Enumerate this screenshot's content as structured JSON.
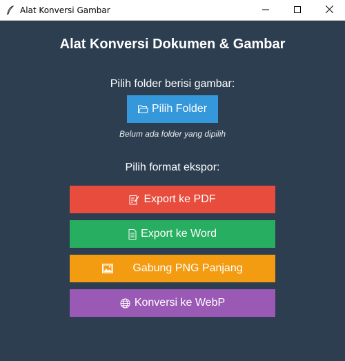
{
  "window": {
    "title": "Alat Konversi Gambar",
    "icons": {
      "app": "feather-icon",
      "minimize": "minimize-icon",
      "maximize": "maximize-icon",
      "close": "close-icon"
    }
  },
  "main": {
    "heading": "Alat Konversi Dokumen & Gambar",
    "folder_prompt": "Pilih folder berisi gambar:",
    "folder_button": {
      "label": "Pilih Folder",
      "icon": "folder-icon",
      "color": "#3498db"
    },
    "folder_status": "Belum ada folder yang dipilih",
    "format_prompt": "Pilih format ekspor:",
    "export_buttons": [
      {
        "label": "Export ke PDF",
        "icon": "pdf-edit-icon",
        "color": "#e74c3c"
      },
      {
        "label": "Export ke Word",
        "icon": "document-icon",
        "color": "#27ae60"
      },
      {
        "label": "Gabung PNG Panjang",
        "icon": "image-icon",
        "color": "#f39c12"
      },
      {
        "label": "Konversi ke WebP",
        "icon": "globe-icon",
        "color": "#9b59b6"
      }
    ]
  },
  "colors": {
    "background": "#2c3e50"
  }
}
